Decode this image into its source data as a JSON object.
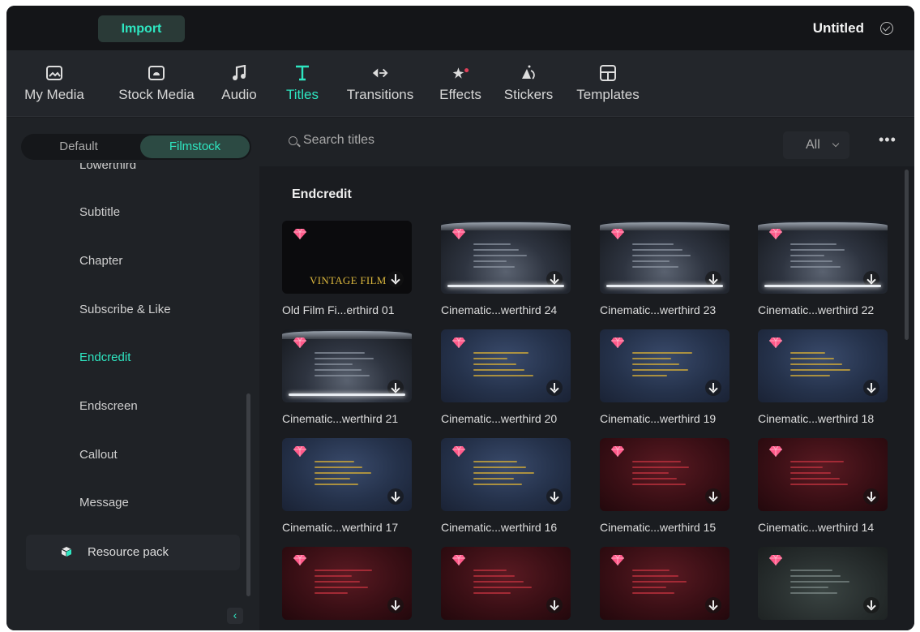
{
  "titlebar": {
    "import_label": "Import",
    "doc_title": "Untitled"
  },
  "tabs": [
    {
      "label": "My Media",
      "icon": "my-media-icon"
    },
    {
      "label": "Stock Media",
      "icon": "stock-media-icon"
    },
    {
      "label": "Audio",
      "icon": "audio-icon"
    },
    {
      "label": "Titles",
      "icon": "titles-icon",
      "active": true
    },
    {
      "label": "Transitions",
      "icon": "transitions-icon"
    },
    {
      "label": "Effects",
      "icon": "effects-icon"
    },
    {
      "label": "Stickers",
      "icon": "stickers-icon"
    },
    {
      "label": "Templates",
      "icon": "templates-icon"
    }
  ],
  "accent_color": "#2ee6c1",
  "sidebar": {
    "segments": {
      "default": "Default",
      "filmstock": "Filmstock"
    },
    "categories": [
      "Lowerthird",
      "Subtitle",
      "Chapter",
      "Subscribe & Like",
      "Endcredit",
      "Endscreen",
      "Callout",
      "Message"
    ],
    "active_category": "Endcredit",
    "resource_pack": "Resource pack"
  },
  "search": {
    "placeholder": "Search titles",
    "filter": "All"
  },
  "section": {
    "title": "Endcredit",
    "items": [
      {
        "label": "Old Film Fi...erthird 01",
        "style": "black"
      },
      {
        "label": "Cinematic...werthird 24",
        "style": "studio"
      },
      {
        "label": "Cinematic...werthird 23",
        "style": "studio"
      },
      {
        "label": "Cinematic...werthird 22",
        "style": "studio"
      },
      {
        "label": "Cinematic...werthird 21",
        "style": "studio"
      },
      {
        "label": "Cinematic...werthird 20",
        "style": "blue"
      },
      {
        "label": "Cinematic...werthird 19",
        "style": "blue"
      },
      {
        "label": "Cinematic...werthird 18",
        "style": "blue"
      },
      {
        "label": "Cinematic...werthird 17",
        "style": "blue"
      },
      {
        "label": "Cinematic...werthird 16",
        "style": "blue"
      },
      {
        "label": "Cinematic...werthird 15",
        "style": "red"
      },
      {
        "label": "Cinematic...werthird 14",
        "style": "red"
      },
      {
        "label": "",
        "style": "red"
      },
      {
        "label": "",
        "style": "red"
      },
      {
        "label": "",
        "style": "red"
      },
      {
        "label": "",
        "style": "dark"
      }
    ],
    "thumb_caption_vintage": "VINTAGE FILM"
  }
}
